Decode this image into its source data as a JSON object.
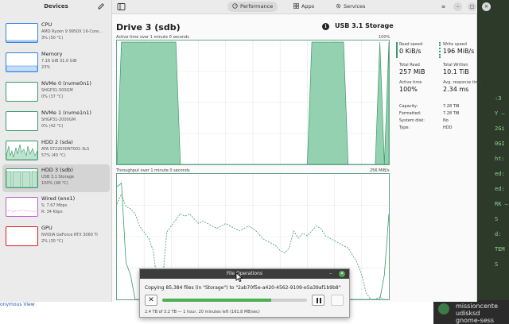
{
  "sidebar": {
    "title": "Devices",
    "devices": [
      {
        "name": "CPU",
        "line1": "AMD Ryzen 9 9950X 16-Core...",
        "line2": "3% (50 °C)",
        "color": "#3584e4",
        "kind": "cpu"
      },
      {
        "name": "Memory",
        "line1": "7.16 GiB 31.0 GiB",
        "line2": "23%",
        "color": "#3584e4",
        "kind": "mem"
      },
      {
        "name": "NVMe 0 (nvme0n1)",
        "line1": "SHGP31-500GM",
        "line2": "0% (37 °C)",
        "color": "#3a9a6a",
        "kind": "flat"
      },
      {
        "name": "NVMe 1 (nvme1n1)",
        "line1": "SHGP31-2000GM",
        "line2": "0% (42 °C)",
        "color": "#3a9a6a",
        "kind": "flat"
      },
      {
        "name": "HDD 2 (sda)",
        "line1": "ATA ST22000NT001-3LS",
        "line2": "57% (40 °C)",
        "color": "#3a9a6a",
        "kind": "busy"
      },
      {
        "name": "HDD 3 (sdb)",
        "line1": "USB 3.1 Storage",
        "line2": "100% (48 °C)",
        "color": "#3a9a6a",
        "kind": "full"
      },
      {
        "name": "Wired (eno1)",
        "line1": "S: 7.67 Mbps",
        "line2": "R: 34 Kbps",
        "color": "#c061cb",
        "kind": "net"
      },
      {
        "name": "GPU",
        "line1": "NVIDIA GeForce RTX 3060 Ti",
        "line2": "2% (30 °C)",
        "color": "#e01b24",
        "kind": "gpu"
      }
    ]
  },
  "header": {
    "tabs": [
      {
        "label": "Performance",
        "active": true
      },
      {
        "label": "Apps",
        "active": false
      },
      {
        "label": "Services",
        "active": false
      }
    ],
    "window_buttons": [
      "≡",
      "–",
      "□",
      "✕"
    ]
  },
  "detail": {
    "title": "Drive 3 (sdb)",
    "model": "USB 3.1 Storage",
    "active_graph_label": "Active time over 1 minute 0 seconds",
    "active_graph_max": "100%",
    "throughput_graph_label": "Throughput over 1 minute 0 seconds",
    "throughput_graph_max": "256 MiB/s",
    "stats": {
      "read_speed_label": "Read speed",
      "read_speed": "0 KiB/s",
      "write_speed_label": "Write speed",
      "write_speed": "196 MiB/s",
      "total_read_label": "Total Read",
      "total_read": "257 MiB",
      "total_written_label": "Total Written",
      "total_written": "10.1 TiB",
      "active_time_label": "Active time",
      "active_time": "100%",
      "response_time_label": "Avg. response time",
      "response_time": "2.34 ms"
    },
    "properties": [
      {
        "key": "Capacity:",
        "value": "7.28 TiB"
      },
      {
        "key": "Formatted:",
        "value": "7.28 TiB"
      },
      {
        "key": "System disk:",
        "value": "No"
      },
      {
        "key": "Type:",
        "value": "HDD"
      }
    ],
    "active_series": [
      0,
      100,
      100,
      100,
      100,
      100,
      100,
      100,
      100,
      100,
      100,
      100,
      100,
      100,
      0,
      0,
      0,
      0,
      0,
      0,
      0,
      0,
      0,
      0,
      0,
      0,
      0,
      0,
      0,
      0,
      0,
      0,
      0,
      0,
      0,
      0,
      0,
      0,
      0,
      0,
      0,
      0,
      0,
      100,
      100,
      100,
      100,
      100,
      100,
      100,
      100,
      0,
      0,
      0,
      0,
      0,
      0,
      0,
      100,
      0,
      100
    ],
    "read_series": [
      78,
      86,
      76,
      74,
      70,
      60,
      55,
      50,
      40,
      10,
      12,
      55,
      60,
      65,
      70,
      68,
      70,
      66,
      62,
      64,
      62,
      60,
      58,
      60,
      62,
      60,
      58,
      56,
      58,
      60,
      58,
      55,
      50,
      48,
      46,
      44,
      40,
      38,
      42,
      56,
      50,
      54,
      52,
      56,
      60,
      58,
      52,
      50,
      48,
      46,
      44,
      42,
      36,
      30,
      20,
      5,
      0,
      0,
      2,
      0,
      0
    ],
    "write_series": [
      92,
      95,
      30,
      20,
      0,
      0,
      0,
      0,
      0,
      0,
      0,
      0,
      0,
      0,
      0,
      0,
      0,
      0,
      0,
      0,
      0,
      0,
      0,
      0,
      0,
      0,
      0,
      0,
      0,
      0,
      0,
      0,
      0,
      0,
      0,
      0,
      0,
      0,
      0,
      0,
      0,
      0,
      0,
      0,
      0,
      0,
      0,
      0,
      0,
      0,
      0,
      0,
      0,
      0,
      0,
      0,
      0,
      0,
      0,
      20,
      70
    ]
  },
  "dialog": {
    "title": "File Operations",
    "message": "Copying 85,384 files (in \"Storage\") to \"2ab70f5e-a420-4562-9109-e5a39af1b9b8\"",
    "progress": 0.75,
    "status": "2.4 TB of 3.2 TB — 1 hour, 20 minutes left (161.8 MB/sec)",
    "cancel_icon": "✕",
    "minimize": "–",
    "close": "✕"
  },
  "background": {
    "link_text": "onymous View",
    "terminal_lines": [
      "missioncente",
      "udisksd",
      "gnome-sess"
    ],
    "right_strip": [
      ":3",
      "Y –",
      "2Gi",
      "0GI",
      "ht:",
      "ed:",
      "ed:",
      "RK –",
      "S",
      "d:",
      "TEM",
      "S"
    ]
  }
}
